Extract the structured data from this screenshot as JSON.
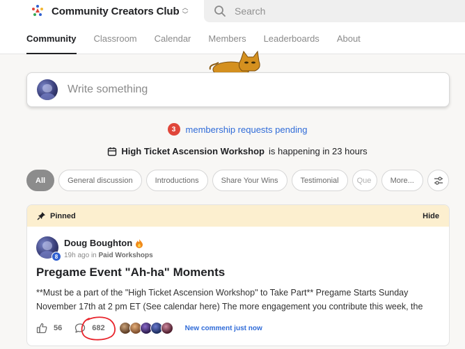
{
  "header": {
    "brand_name": "Community Creators Club",
    "search_placeholder": "Search"
  },
  "tabs": [
    {
      "label": "Community",
      "active": true
    },
    {
      "label": "Classroom",
      "active": false
    },
    {
      "label": "Calendar",
      "active": false
    },
    {
      "label": "Members",
      "active": false
    },
    {
      "label": "Leaderboards",
      "active": false
    },
    {
      "label": "About",
      "active": false
    }
  ],
  "composer": {
    "placeholder": "Write something"
  },
  "pending": {
    "count": "3",
    "text": "membership requests pending"
  },
  "event": {
    "name": "High Ticket Ascension Workshop",
    "suffix": "is happening in 23 hours"
  },
  "filters": {
    "chips": [
      "All",
      "General discussion",
      "Introductions",
      "Share Your Wins",
      "Testimonial",
      "Que",
      "More..."
    ],
    "selected": "All"
  },
  "post": {
    "pinned_label": "Pinned",
    "hide_label": "Hide",
    "author": "Doug Boughton",
    "level": "8",
    "time": "19h ago",
    "in_label": "in",
    "category": "Paid Workshops",
    "title": "Pregame Event \"Ah-ha\" Moments",
    "body": "**Must be a part of the \"High Ticket Ascension Workshop\" to Take Part** Pregame Starts Sunday November 17th at 2 pm ET (See calendar here) The more engagement you contribute this week, the",
    "likes": "56",
    "comments": "682",
    "new_comment": "New comment just now"
  },
  "colors": {
    "accent_blue": "#2f6bd8",
    "badge_red": "#e0463a",
    "pinned_bg": "#fcefcf",
    "cat_orange": "#d4901f",
    "annotation_red": "#e8232b"
  }
}
